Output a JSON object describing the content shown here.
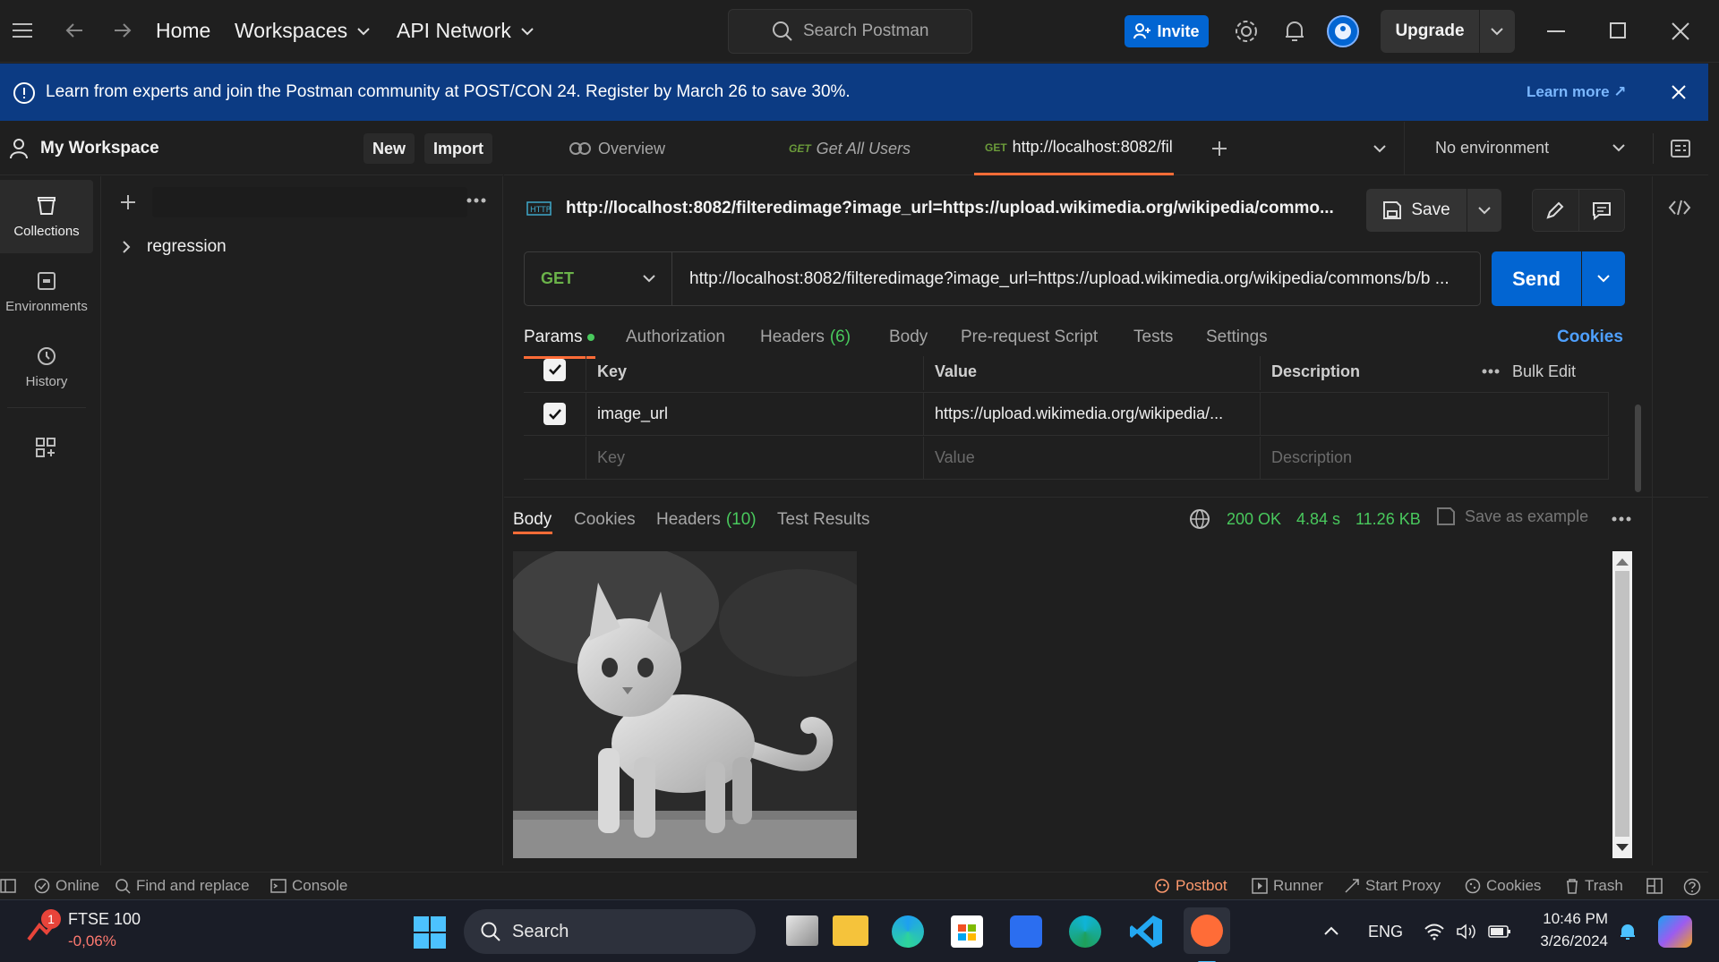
{
  "topbar": {
    "nav": {
      "home": "Home",
      "workspaces": "Workspaces",
      "api_network": "API Network"
    },
    "search_placeholder": "Search Postman",
    "invite": "Invite",
    "upgrade": "Upgrade"
  },
  "banner": {
    "text": "Learn from experts and join the Postman community at POST/CON 24. Register by March 26 to save 30%.",
    "link": "Learn more ↗"
  },
  "sidebar": {
    "workspace_title": "My Workspace",
    "new_label": "New",
    "import_label": "Import",
    "rail": [
      {
        "label": "Collections",
        "icon": "collections-icon"
      },
      {
        "label": "Environments",
        "icon": "environments-icon"
      },
      {
        "label": "History",
        "icon": "history-icon"
      }
    ],
    "tree": [
      {
        "label": "regression"
      }
    ]
  },
  "tabs": {
    "overview": "Overview",
    "tab1": {
      "method": "GET",
      "label": "Get All Users"
    },
    "tab2": {
      "method": "GET",
      "label": "http://localhost:8082/fil"
    },
    "environment": "No environment"
  },
  "request": {
    "title_url": "http://localhost:8082/filteredimage?image_url=https://upload.wikimedia.org/wikipedia/commo...",
    "save": "Save",
    "method": "GET",
    "url": "http://localhost:8082/filteredimage?image_url=https://upload.wikimedia.org/wikipedia/commons/b/b ...",
    "send": "Send",
    "subtabs": {
      "params": "Params",
      "authorization": "Authorization",
      "headers": "Headers",
      "headers_count": "(6)",
      "body": "Body",
      "prerequest": "Pre-request Script",
      "tests": "Tests",
      "settings": "Settings",
      "cookies": "Cookies"
    },
    "params_table": {
      "headers": {
        "key": "Key",
        "value": "Value",
        "description": "Description",
        "bulk_edit": "Bulk Edit"
      },
      "rows": [
        {
          "checked": true,
          "key": "image_url",
          "value": "https://upload.wikimedia.org/wikipedia/...",
          "description": ""
        }
      ],
      "placeholder": {
        "key": "Key",
        "value": "Value",
        "description": "Description"
      }
    }
  },
  "response": {
    "tabs": {
      "body": "Body",
      "cookies": "Cookies",
      "headers": "Headers",
      "headers_count": "(10)",
      "test_results": "Test Results"
    },
    "status": "200 OK",
    "time": "4.84 s",
    "size": "11.26 KB",
    "save_example": "Save as example"
  },
  "statusbar": {
    "online": "Online",
    "find_replace": "Find and replace",
    "console": "Console",
    "postbot": "Postbot",
    "runner": "Runner",
    "start_proxy": "Start Proxy",
    "cookies": "Cookies",
    "trash": "Trash"
  },
  "taskbar": {
    "widget_name": "FTSE 100",
    "widget_value": "-0,06%",
    "widget_badge": "1",
    "search": "Search",
    "lang": "ENG",
    "time": "10:46 PM",
    "date": "3/26/2024"
  },
  "colors": {
    "accent_blue": "#0265d2",
    "banner_bg": "#0c3b83",
    "orange": "#ff6c37",
    "green": "#49c95d"
  }
}
